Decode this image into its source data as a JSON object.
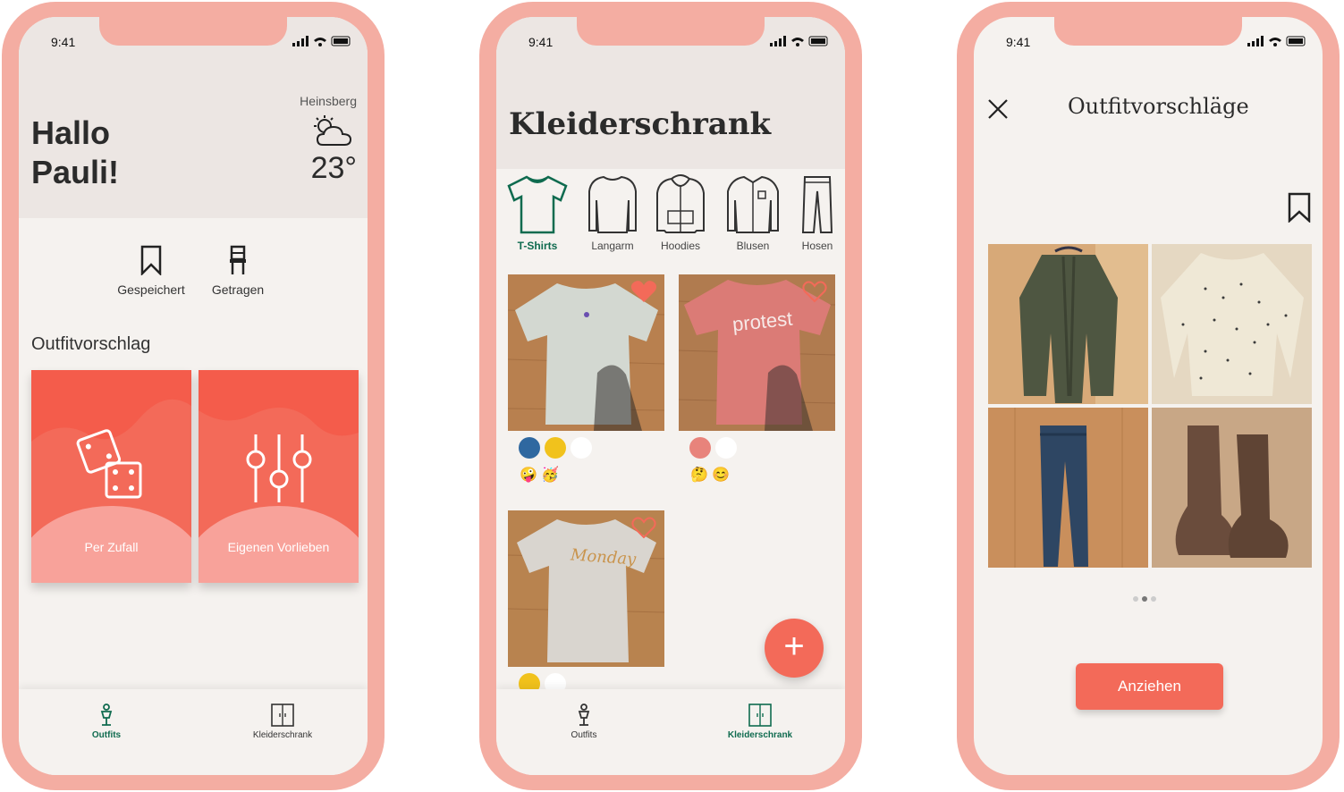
{
  "status": {
    "time": "9:41"
  },
  "home": {
    "greeting_line1": "Hallo",
    "greeting_line2": "Pauli!",
    "city": "Heinsberg",
    "weather_icon": "partly-cloudy-icon",
    "temperature": "23°",
    "quick_saved": "Gespeichert",
    "quick_worn": "Getragen",
    "section_title": "Outfitvorschlag",
    "card_random": "Per Zufall",
    "card_custom": "Eigenen Vorlieben"
  },
  "tabs": {
    "outfits": "Outfits",
    "wardrobe": "Kleiderschrank"
  },
  "wardrobe": {
    "title": "Kleiderschrank",
    "categories": [
      "T-Shirts",
      "Langarm",
      "Hoodies",
      "Blusen",
      "Hosen"
    ],
    "items": [
      {
        "colors": [
          "#2f68a0",
          "#f1c21c",
          "#ffffff"
        ],
        "emojis": "🤪 🥳",
        "favorite": true,
        "print": ""
      },
      {
        "colors": [
          "#e8837b",
          "#ffffff"
        ],
        "emojis": "🤔 😊",
        "favorite": false,
        "print": "protest"
      },
      {
        "colors": [
          "#f1c21c",
          "#ffffff"
        ],
        "emojis": "",
        "favorite": false,
        "print": "Monday"
      }
    ],
    "add_label": "+"
  },
  "suggestions": {
    "title": "Outfitvorschläge",
    "wear_button": "Anziehen",
    "page_index": 2,
    "page_count": 3
  },
  "colors": {
    "accent": "#f36a59",
    "frame": "#f4ada2",
    "active_tab": "#0f6b4f",
    "background": "#f5f2ef"
  }
}
